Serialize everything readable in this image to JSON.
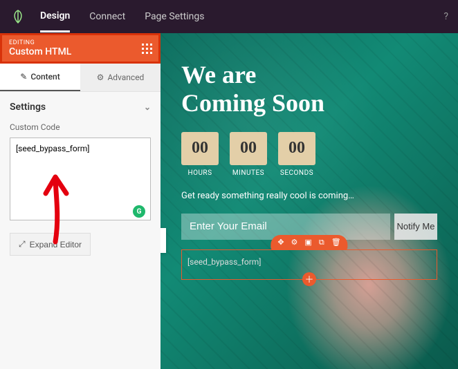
{
  "topbar": {
    "tabs": [
      "Design",
      "Connect",
      "Page Settings"
    ],
    "active": 0
  },
  "editing": {
    "label": "EDITING",
    "block": "Custom HTML"
  },
  "subtabs": {
    "content": "Content",
    "advanced": "Advanced"
  },
  "settings": {
    "title": "Settings",
    "code_label": "Custom Code",
    "code_value": "[seed_bypass_form]",
    "expand": "Expand Editor"
  },
  "preview": {
    "headline1": "We are",
    "headline2": "Coming Soon",
    "timer": [
      {
        "val": "00",
        "lbl": "HOURS"
      },
      {
        "val": "00",
        "lbl": "MINUTES"
      },
      {
        "val": "00",
        "lbl": "SECONDS"
      }
    ],
    "tagline": "Get ready something really cool is coming…",
    "email_placeholder": "Enter Your Email",
    "notify": "Notify Me",
    "shortcode": "[seed_bypass_form]"
  },
  "colors": {
    "accent": "#eb5a2d"
  }
}
